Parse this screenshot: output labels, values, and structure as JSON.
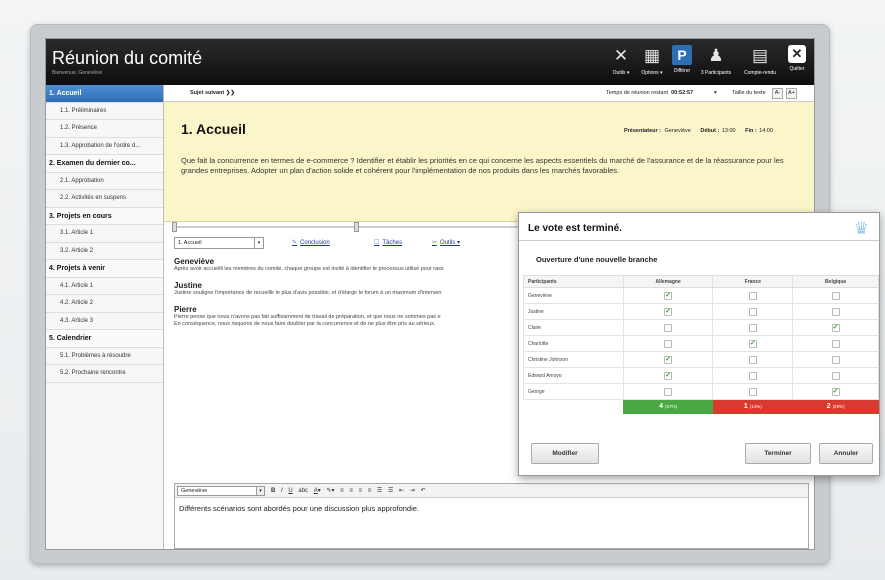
{
  "app": {
    "title": "Réunion du comité",
    "subtitle": "Bienvenue, Geneviève"
  },
  "toolbar": [
    {
      "label": "Outils ▾",
      "icon": "tools-icon"
    },
    {
      "label": "Options ▾",
      "icon": "options-icon"
    },
    {
      "label": "Différer",
      "icon": "parking-icon"
    },
    {
      "label": "3 Participants",
      "icon": "participants-icon"
    },
    {
      "label": "Compte-rendu",
      "icon": "minutes-icon"
    },
    {
      "label": "Quitter",
      "icon": "close-icon"
    }
  ],
  "sidebar": {
    "items": [
      {
        "label": "1. Accueil",
        "type": "section",
        "active": true
      },
      {
        "label": "1.1. Préliminaires",
        "type": "sub"
      },
      {
        "label": "1.2. Présence",
        "type": "sub"
      },
      {
        "label": "1.3. Approbation de l'ordre d...",
        "type": "sub"
      },
      {
        "label": "2. Examen du dernier co...",
        "type": "section"
      },
      {
        "label": "2.1. Approbation",
        "type": "sub"
      },
      {
        "label": "2.2. Activités en suspens",
        "type": "sub"
      },
      {
        "label": "3. Projets en cours",
        "type": "section"
      },
      {
        "label": "3.1. Article 1",
        "type": "sub"
      },
      {
        "label": "3.2. Article 2",
        "type": "sub"
      },
      {
        "label": "4. Projets à venir",
        "type": "section"
      },
      {
        "label": "4.1. Article 1",
        "type": "sub"
      },
      {
        "label": "4.2. Article 2",
        "type": "sub"
      },
      {
        "label": "4.3. Article 3",
        "type": "sub"
      },
      {
        "label": "5. Calendrier",
        "type": "section"
      },
      {
        "label": "5.1. Problèmes à résoudre",
        "type": "sub"
      },
      {
        "label": "5.2. Prochaine rencontre",
        "type": "sub"
      }
    ]
  },
  "topline": {
    "next_topic": "Sujet suivant ❯❯",
    "time_label": "Temps de réunion restant",
    "time_value": "00:52:57",
    "text_size_label": "Taille du texte",
    "smaller": "A-",
    "larger": "A+"
  },
  "topic": {
    "title": "1. Accueil",
    "presenter_label": "Présentateur :",
    "presenter": "Geneviève",
    "start_label": "Début :",
    "start": "13:00",
    "end_label": "Fin :",
    "end": "14:00",
    "description": "Que fait la concurrence en termes de e-commerce ? Identifier et établir les priorités en ce qui concerne les aspects essentiels du marché de l'assurance et de la réassurance pour les grandes entreprises. Adopter un plan d'action solide et cohérent pour l'implémentation de nos produits dans les marchés favorables."
  },
  "notes_bar": {
    "select": "1. Accueil",
    "conclusion": "Conclusion",
    "tasks": "Tâches",
    "tools": "Outils ▾"
  },
  "notes": [
    {
      "name": "Geneviève",
      "text": "Après avoir accueilli les membres du comité, chaque groupe est invité à identifier le processus utilisé pour rass"
    },
    {
      "name": "Justine",
      "text": "Justine souligne l'importance de recueillir le plus d'avis possible, et d'élargir le forum à un maximum d'interven"
    },
    {
      "name": "Pierre",
      "text": "Pierre pense que nous n'avons pas fait suffisamment de travail de préparation, et que nous ne sommes pas e\nEn conséquence, nous risquons de nous faire doubler par la concurrence et de ne plus être pris au sérieux."
    }
  ],
  "editor": {
    "author": "Geneviève",
    "content": "Différents scénarios sont abordés pour une discussion plus approfondie."
  },
  "vote": {
    "title": "Le vote est terminé.",
    "question": "Ouverture d'une nouvelle branche",
    "columns": [
      "Participants",
      "Allemagne",
      "France",
      "Belgique"
    ],
    "rows": [
      {
        "name": "Geneviève",
        "votes": [
          true,
          false,
          false
        ]
      },
      {
        "name": "Justine",
        "votes": [
          true,
          false,
          false
        ]
      },
      {
        "name": "Claire",
        "votes": [
          false,
          false,
          true
        ]
      },
      {
        "name": "Charlotte",
        "votes": [
          false,
          true,
          false
        ]
      },
      {
        "name": "Christine Johnson",
        "votes": [
          true,
          false,
          false
        ]
      },
      {
        "name": "Edward Amoyo",
        "votes": [
          true,
          false,
          false
        ]
      },
      {
        "name": "George",
        "votes": [
          false,
          false,
          true
        ]
      }
    ],
    "totals": [
      {
        "count": "4",
        "pct": "(57%)",
        "color": "#4aa844"
      },
      {
        "count": "1",
        "pct": "(14%)",
        "color": "#d83a2f"
      },
      {
        "count": "2",
        "pct": "(29%)",
        "color": "#d83a2f"
      }
    ],
    "modify": "Modifier",
    "finish": "Terminer",
    "cancel": "Annuler"
  }
}
